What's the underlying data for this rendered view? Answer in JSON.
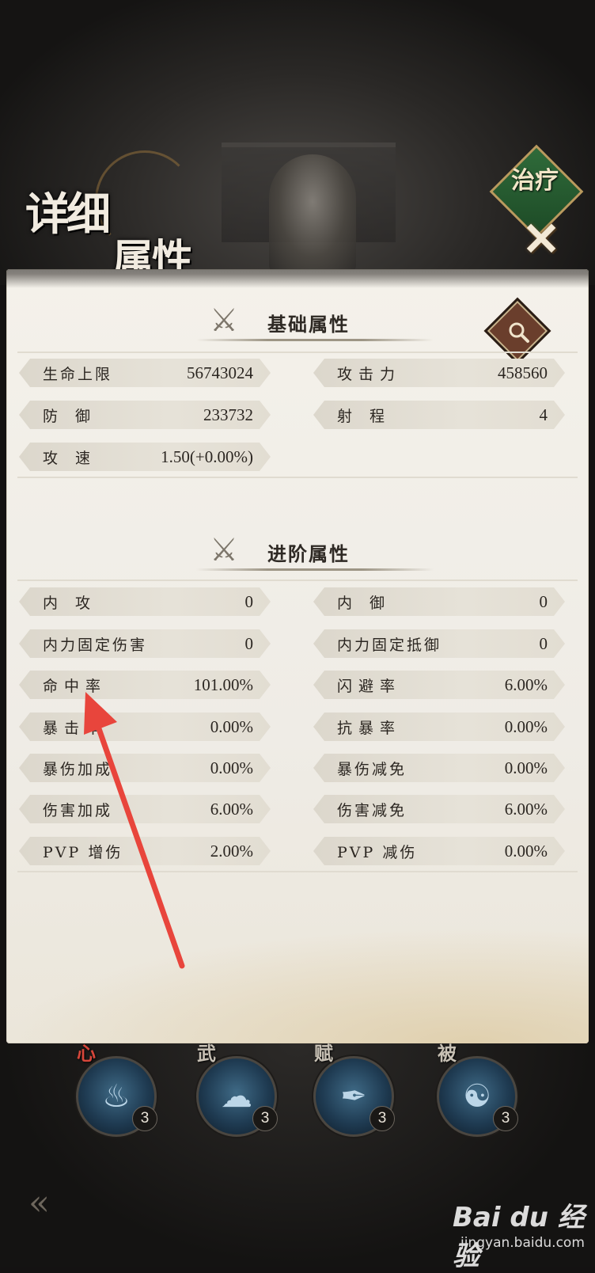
{
  "header": {
    "title_line1": "详细",
    "title_line2": "属性",
    "tag_text": "治疗",
    "close_icon": "close-icon"
  },
  "basic": {
    "title": "基础属性",
    "search_icon": "magnifier-icon",
    "stats": [
      {
        "label": "生命上限",
        "value": "56743024"
      },
      {
        "label": "攻击力",
        "value": "458560"
      },
      {
        "label": "防 御",
        "value": "233732"
      },
      {
        "label": "射 程",
        "value": "4"
      },
      {
        "label": "攻 速",
        "value": "1.50(+0.00%)"
      }
    ]
  },
  "advanced": {
    "title": "进阶属性",
    "stats": [
      {
        "label": "内 攻",
        "value": "0"
      },
      {
        "label": "内 御",
        "value": "0"
      },
      {
        "label": "内力固定伤害",
        "value": "0"
      },
      {
        "label": "内力固定抵御",
        "value": "0"
      },
      {
        "label": "命中率",
        "value": "101.00%"
      },
      {
        "label": "闪避率",
        "value": "6.00%"
      },
      {
        "label": "暴击率",
        "value": "0.00%"
      },
      {
        "label": "抗暴率",
        "value": "0.00%"
      },
      {
        "label": "暴伤加成",
        "value": "0.00%"
      },
      {
        "label": "暴伤减免",
        "value": "0.00%"
      },
      {
        "label": "伤害加成",
        "value": "6.00%"
      },
      {
        "label": "伤害减免",
        "value": "6.00%"
      },
      {
        "label": "PVP 增伤",
        "value": "2.00%"
      },
      {
        "label": "PVP 减伤",
        "value": "0.00%"
      }
    ]
  },
  "skills": [
    {
      "tag": "心",
      "count": "3",
      "icon": "lamp-icon"
    },
    {
      "tag": "武",
      "count": "3",
      "icon": "dragon-icon"
    },
    {
      "tag": "赋",
      "count": "3",
      "icon": "feather-icon"
    },
    {
      "tag": "被",
      "count": "3",
      "icon": "yin-yang-icon"
    }
  ],
  "footer": {
    "back_icon": "back-arrow-icon",
    "watermark_logo": "Bai du 经验",
    "watermark_url": "jingyan.baidu.com"
  },
  "annotation": {
    "arrow_color": "#e8453c"
  }
}
